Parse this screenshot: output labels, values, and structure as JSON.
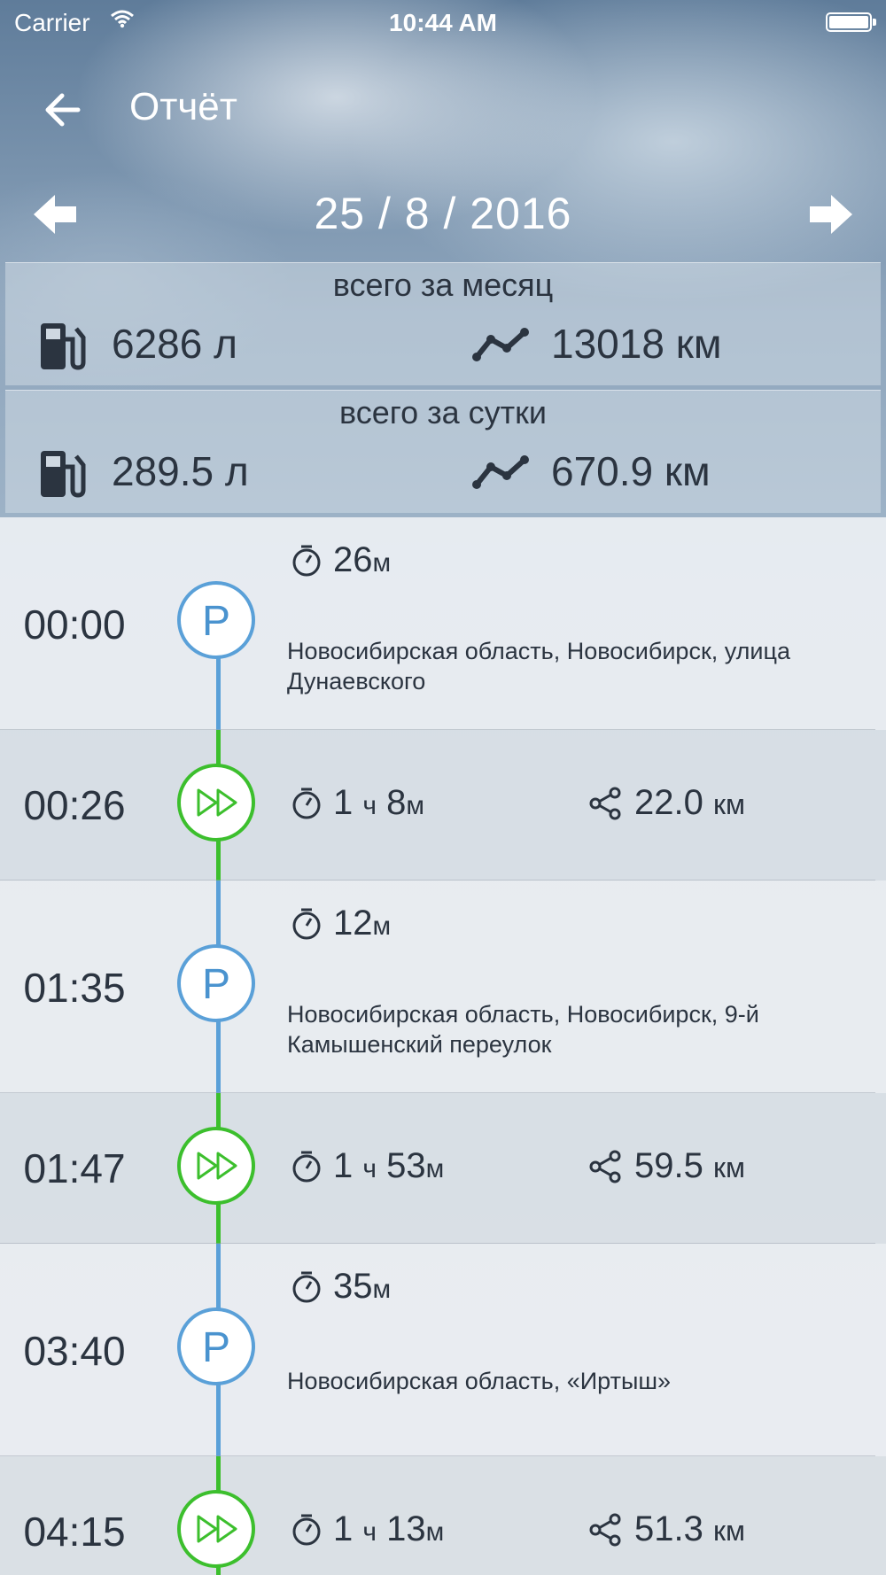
{
  "status_bar": {
    "carrier": "Carrier",
    "time": "10:44 AM"
  },
  "header": {
    "title": "Отчёт",
    "date": "25 / 8 / 2016"
  },
  "summary": {
    "month": {
      "label": "всего за месяц",
      "fuel": "6286 л",
      "distance": "13018 км"
    },
    "day": {
      "label": "всего за сутки",
      "fuel": "289.5 л",
      "distance": "670.9 км"
    }
  },
  "timeline": [
    {
      "type": "parking",
      "time": "00:00",
      "icon": "P",
      "duration_num": "26",
      "duration_unit": "м",
      "address": "Новосибирская область, Новосибирск, улица Дунаевского"
    },
    {
      "type": "driving",
      "time": "00:26",
      "duration_num": "1",
      "duration_mid": "ч",
      "duration_num2": "8",
      "duration_unit": "м",
      "distance_num": "22.0",
      "distance_unit": "км"
    },
    {
      "type": "parking",
      "time": "01:35",
      "icon": "P",
      "duration_num": "12",
      "duration_unit": "м",
      "address": "Новосибирская область, Новосибирск, 9-й Камышенский переулок"
    },
    {
      "type": "driving",
      "time": "01:47",
      "duration_num": "1",
      "duration_mid": "ч",
      "duration_num2": "53",
      "duration_unit": "м",
      "distance_num": "59.5",
      "distance_unit": "км"
    },
    {
      "type": "parking",
      "time": "03:40",
      "icon": "P",
      "duration_num": "35",
      "duration_unit": "м",
      "address": "Новосибирская область, «Иртыш»"
    },
    {
      "type": "driving",
      "time": "04:15",
      "duration_num": "1",
      "duration_mid": "ч",
      "duration_num2": "13",
      "duration_unit": "м",
      "distance_num": "51.3",
      "distance_unit": "км"
    }
  ],
  "colors": {
    "parking": "#5aa0d8",
    "driving": "#3cbf2d",
    "text": "#2b3440"
  },
  "icons": [
    "back-arrow-icon",
    "prev-day-icon",
    "next-day-icon",
    "fuel-pump-icon",
    "route-icon",
    "timer-icon",
    "share-distance-icon",
    "fast-forward-icon",
    "wifi-icon",
    "battery-icon"
  ]
}
